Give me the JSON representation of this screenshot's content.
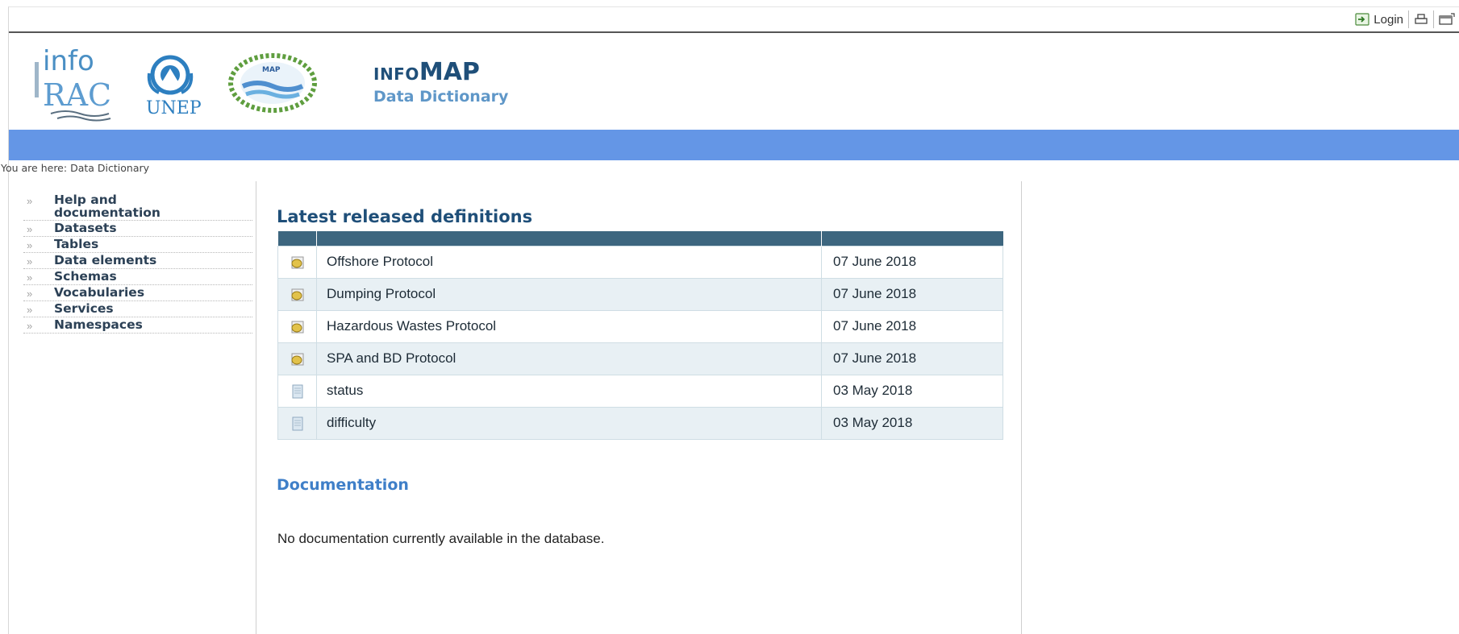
{
  "toolbar": {
    "login_label": "Login",
    "print_icon": "printer-icon",
    "fullscreen_icon": "fullscreen-icon"
  },
  "header": {
    "logos": {
      "info_top": "info",
      "info_bottom": "RAC",
      "unep": "UNEP",
      "map": "MAP"
    },
    "title_prefix": "INFO",
    "title_main": "MAP",
    "subtitle": "Data Dictionary"
  },
  "colors": {
    "accent_bar": "#6496e6",
    "title": "#1f4f79",
    "table_header": "#3d667f"
  },
  "breadcrumb": {
    "prefix": "You are here:",
    "current": "Data Dictionary"
  },
  "leftnav": {
    "arrow": "»",
    "items": [
      {
        "label": "Help and documentation"
      },
      {
        "label": "Datasets"
      },
      {
        "label": "Tables"
      },
      {
        "label": "Data elements"
      },
      {
        "label": "Schemas"
      },
      {
        "label": "Vocabularies"
      },
      {
        "label": "Services"
      },
      {
        "label": "Namespaces"
      }
    ]
  },
  "main": {
    "section_title": "Latest released definitions",
    "rows": [
      {
        "icon": "dataset-icon",
        "name": "Offshore Protocol",
        "date": "07 June 2018"
      },
      {
        "icon": "dataset-icon",
        "name": "Dumping Protocol",
        "date": "07 June 2018"
      },
      {
        "icon": "dataset-icon",
        "name": "Hazardous Wastes Protocol",
        "date": "07 June 2018"
      },
      {
        "icon": "dataset-icon",
        "name": "SPA and BD Protocol",
        "date": "07 June 2018"
      },
      {
        "icon": "document-icon",
        "name": "status",
        "date": "03 May 2018"
      },
      {
        "icon": "document-icon",
        "name": "difficulty",
        "date": "03 May 2018"
      }
    ],
    "documentation_title": "Documentation",
    "documentation_text": "No documentation currently available in the database."
  }
}
